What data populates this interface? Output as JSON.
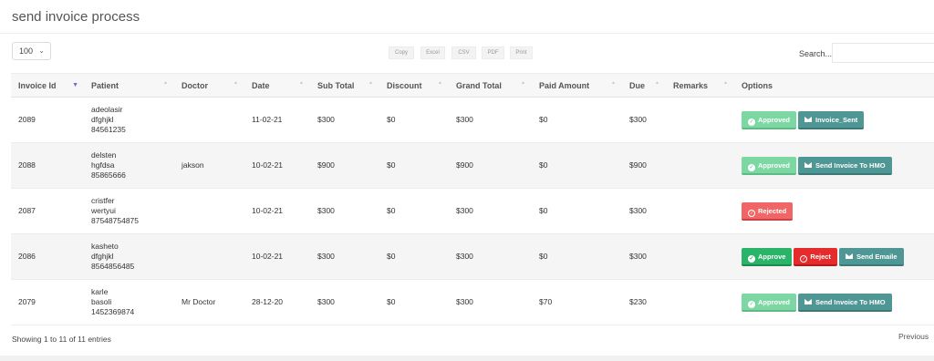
{
  "title": "send invoice process",
  "length": {
    "value": "100"
  },
  "exports": [
    "Copy",
    "Excel",
    "CSV",
    "PDF",
    "Print"
  ],
  "search": {
    "label": "Search..."
  },
  "columns": [
    "Invoice Id",
    "Patient",
    "Doctor",
    "Date",
    "Sub Total",
    "Discount",
    "Grand Total",
    "Paid Amount",
    "Due",
    "Remarks",
    "Options"
  ],
  "rows": [
    {
      "id": "2089",
      "patient": [
        "adeolasir",
        "dfghjkl",
        "84561235"
      ],
      "doctor": "",
      "date": "11-02-21",
      "sub": "$300",
      "disc": "$0",
      "grand": "$300",
      "paid": "$0",
      "due": "$300",
      "remarks": "",
      "buttons": [
        {
          "type": "approved",
          "label": "Approved"
        },
        {
          "type": "send",
          "label": "Invoice_Sent"
        }
      ]
    },
    {
      "id": "2088",
      "patient": [
        "delsten",
        "hgfdsa",
        "85865666"
      ],
      "doctor": "jakson",
      "date": "10-02-21",
      "sub": "$900",
      "disc": "$0",
      "grand": "$900",
      "paid": "$0",
      "due": "$900",
      "remarks": "",
      "buttons": [
        {
          "type": "approved",
          "label": "Approved"
        },
        {
          "type": "send",
          "label": "Send Invoice To HMO"
        }
      ]
    },
    {
      "id": "2087",
      "patient": [
        "cristfer",
        "wertyui",
        "87548754875"
      ],
      "doctor": "",
      "date": "10-02-21",
      "sub": "$300",
      "disc": "$0",
      "grand": "$300",
      "paid": "$0",
      "due": "$300",
      "remarks": "",
      "buttons": [
        {
          "type": "rejected",
          "label": "Rejected"
        }
      ]
    },
    {
      "id": "2086",
      "patient": [
        "kasheto",
        "dfghjkl",
        "8564856485"
      ],
      "doctor": "",
      "date": "10-02-21",
      "sub": "$300",
      "disc": "$0",
      "grand": "$300",
      "paid": "$0",
      "due": "$300",
      "remarks": "",
      "buttons": [
        {
          "type": "approve",
          "label": "Approve"
        },
        {
          "type": "reject",
          "label": "Reject"
        },
        {
          "type": "send",
          "label": "Send Emaile"
        }
      ]
    },
    {
      "id": "2079",
      "patient": [
        "karle",
        "basoli",
        "1452369874"
      ],
      "doctor": "Mr Doctor",
      "date": "28-12-20",
      "sub": "$300",
      "disc": "$0",
      "grand": "$300",
      "paid": "$70",
      "due": "$230",
      "remarks": "",
      "buttons": [
        {
          "type": "approved",
          "label": "Approved"
        },
        {
          "type": "send",
          "label": "Send Invoice To HMO"
        }
      ]
    }
  ],
  "info": "Showing 1 to 11 of 11 entries",
  "pager": {
    "previous": "Previous"
  }
}
